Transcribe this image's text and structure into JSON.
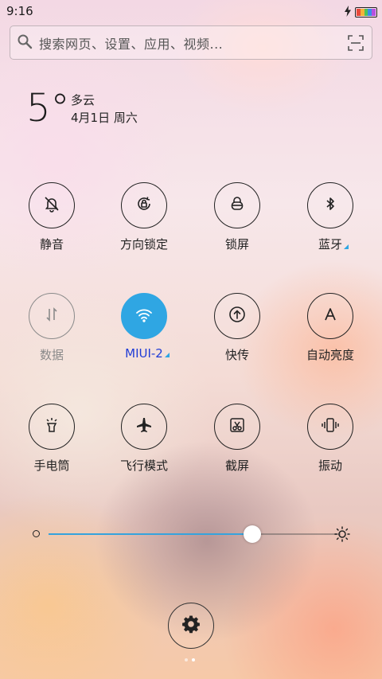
{
  "status_bar": {
    "time": "9:16",
    "battery_colors": [
      "#e84a3a",
      "#f3b23a",
      "#4cc35a",
      "#3a8ee8",
      "#b650e0"
    ]
  },
  "search": {
    "placeholder": "搜索网页、设置、应用、视频..."
  },
  "weather": {
    "temperature": "5°",
    "condition": "多云",
    "date": "4月1日 周六"
  },
  "toggles": [
    {
      "label": "静音",
      "icon": "bell-off-icon",
      "state": "off"
    },
    {
      "label": "方向锁定",
      "icon": "rotation-lock-icon",
      "state": "off"
    },
    {
      "label": "锁屏",
      "icon": "lock-icon",
      "state": "off"
    },
    {
      "label": "蓝牙",
      "icon": "bluetooth-icon",
      "state": "off",
      "has_menu": true
    },
    {
      "label": "数据",
      "icon": "mobile-data-icon",
      "state": "disabled"
    },
    {
      "label": "MIUI-2",
      "icon": "wifi-icon",
      "state": "on",
      "has_menu": true
    },
    {
      "label": "快传",
      "icon": "transfer-icon",
      "state": "off"
    },
    {
      "label": "自动亮度",
      "icon": "auto-brightness-icon",
      "state": "off"
    },
    {
      "label": "手电筒",
      "icon": "flashlight-icon",
      "state": "off"
    },
    {
      "label": "飞行模式",
      "icon": "airplane-icon",
      "state": "off"
    },
    {
      "label": "截屏",
      "icon": "screenshot-icon",
      "state": "off"
    },
    {
      "label": "振动",
      "icon": "vibrate-icon",
      "state": "off"
    }
  ],
  "brightness": {
    "level": 0.697,
    "accent": "#35a3dd"
  },
  "colors": {
    "active": "#2fa6e3",
    "active_label": "#1f3cd6"
  },
  "pages": {
    "count": 2,
    "current": 2
  }
}
